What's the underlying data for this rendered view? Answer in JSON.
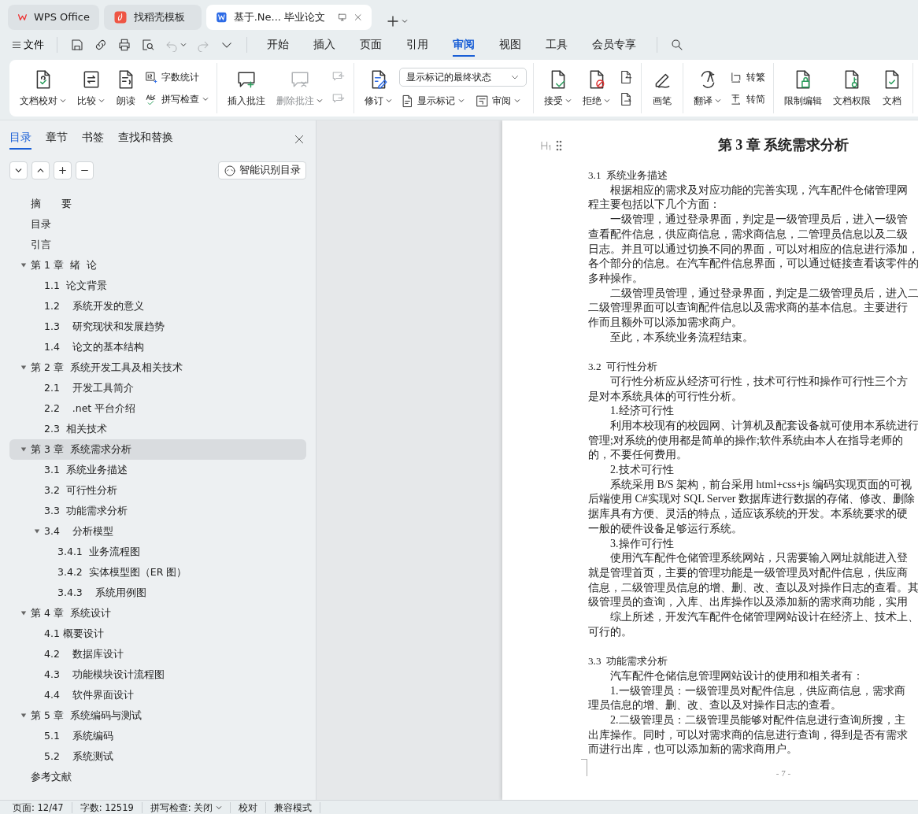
{
  "browser_tabs": [
    {
      "label": "WPS Office",
      "selected": false
    },
    {
      "label": "找稻壳模板",
      "selected": false
    },
    {
      "label": "基于.Ne... 毕业论文",
      "selected": true
    }
  ],
  "menu": {
    "file": "文件",
    "quick_access": [
      {
        "disabled": false
      },
      {
        "disabled": false
      },
      {
        "disabled": false
      },
      {
        "disabled": false
      },
      {
        "disabled": true
      },
      {
        "disabled": true
      },
      {
        "disabled": false
      }
    ],
    "tabs": [
      {
        "label": "开始",
        "selected": false
      },
      {
        "label": "插入",
        "selected": false
      },
      {
        "label": "页面",
        "selected": false
      },
      {
        "label": "引用",
        "selected": false
      },
      {
        "label": "审阅",
        "selected": true
      },
      {
        "label": "视图",
        "selected": false
      },
      {
        "label": "工具",
        "selected": false
      },
      {
        "label": "会员专享",
        "selected": false
      }
    ]
  },
  "ribbon": {
    "groups": [
      {
        "items": [
          {
            "kind": "big",
            "label": "文档校对",
            "dropdown": true,
            "disabled": false
          },
          {
            "kind": "big",
            "label": "比较",
            "dropdown": true,
            "disabled": false
          },
          {
            "kind": "big",
            "label": "朗读",
            "dropdown": false,
            "disabled": false
          },
          {
            "kind": "stack",
            "rows": [
              [
                {
                  "kind": "small",
                  "label": "字数统计",
                  "dropdown": false,
                  "disabled": false
                }
              ],
              [
                {
                  "kind": "small",
                  "label": "拼写检查",
                  "dropdown": true,
                  "disabled": false
                }
              ]
            ]
          }
        ]
      },
      {
        "items": [
          {
            "kind": "big",
            "label": "插入批注",
            "dropdown": false,
            "disabled": false
          },
          {
            "kind": "big",
            "label": "删除批注",
            "dropdown": true,
            "disabled": true
          },
          {
            "kind": "stack",
            "rows": [
              [
                {
                  "kind": "icon",
                  "disabled": true
                }
              ],
              [
                {
                  "kind": "icon",
                  "disabled": true
                }
              ]
            ]
          }
        ]
      },
      {
        "items": [
          {
            "kind": "big",
            "label": "修订",
            "dropdown": true,
            "disabled": false
          },
          {
            "kind": "stack",
            "rows": [
              [
                {
                  "kind": "select",
                  "label": "显示标记的最终状态",
                  "dropdown": true
                }
              ],
              [
                {
                  "kind": "small",
                  "label": "显示标记",
                  "dropdown": true,
                  "disabled": false
                },
                {
                  "kind": "small",
                  "label": "审阅",
                  "dropdown": true,
                  "disabled": false
                }
              ]
            ]
          }
        ]
      },
      {
        "items": [
          {
            "kind": "big",
            "label": "接受",
            "dropdown": true,
            "disabled": false
          },
          {
            "kind": "big",
            "label": "拒绝",
            "dropdown": true,
            "disabled": false
          },
          {
            "kind": "stack",
            "rows": [
              [
                {
                  "kind": "icon",
                  "disabled": false
                }
              ],
              [
                {
                  "kind": "icon",
                  "disabled": false
                }
              ]
            ]
          }
        ]
      },
      {
        "items": [
          {
            "kind": "big",
            "label": "画笔",
            "dropdown": false,
            "disabled": false
          }
        ]
      },
      {
        "items": [
          {
            "kind": "big",
            "label": "翻译",
            "dropdown": true,
            "disabled": false
          },
          {
            "kind": "stack",
            "rows": [
              [
                {
                  "kind": "small",
                  "label": "转繁",
                  "dropdown": false,
                  "disabled": false
                }
              ],
              [
                {
                  "kind": "small",
                  "label": "转简",
                  "dropdown": false,
                  "disabled": false
                }
              ]
            ]
          }
        ]
      },
      {
        "items": [
          {
            "kind": "big",
            "label": "限制编辑",
            "dropdown": false,
            "disabled": false
          },
          {
            "kind": "big",
            "label": "文档权限",
            "dropdown": false,
            "disabled": false
          },
          {
            "kind": "big",
            "label": "文档",
            "dropdown": false,
            "disabled": false
          }
        ]
      }
    ]
  },
  "sidebar": {
    "tabs": [
      {
        "label": "目录",
        "selected": true
      },
      {
        "label": "章节",
        "selected": false
      },
      {
        "label": "书签",
        "selected": false
      },
      {
        "label": "查找和替换",
        "selected": false
      }
    ],
    "smart_button": "智能识别目录",
    "toc": [
      {
        "label": "摘　　要",
        "selected": false
      },
      {
        "label": "目录",
        "selected": false
      },
      {
        "label": "引言",
        "selected": false
      },
      {
        "label": "第 1 章  绪  论",
        "selected": false,
        "expanded": true,
        "children": [
          {
            "label": "1.1  论文背景",
            "selected": false
          },
          {
            "label": "1.2    系统开发的意义",
            "selected": false
          },
          {
            "label": "1.3    研究现状和发展趋势",
            "selected": false
          },
          {
            "label": "1.4    论文的基本结构",
            "selected": false
          }
        ]
      },
      {
        "label": "第 2 章  系统开发工具及相关技术",
        "selected": false,
        "expanded": true,
        "children": [
          {
            "label": "2.1    开发工具简介",
            "selected": false
          },
          {
            "label": "2.2    .net 平台介绍",
            "selected": false
          },
          {
            "label": "2.3  相关技术",
            "selected": false
          }
        ]
      },
      {
        "label": "第 3 章  系统需求分析",
        "selected": true,
        "expanded": true,
        "children": [
          {
            "label": "3.1  系统业务描述",
            "selected": false
          },
          {
            "label": "3.2  可行性分析",
            "selected": false
          },
          {
            "label": "3.3  功能需求分析",
            "selected": false
          },
          {
            "label": "3.4    分析模型",
            "selected": false,
            "expanded": true,
            "children": [
              {
                "label": "3.4.1  业务流程图",
                "selected": false
              },
              {
                "label": "3.4.2  实体模型图（ER 图）",
                "selected": false
              },
              {
                "label": "3.4.3    系统用例图",
                "selected": false
              }
            ]
          }
        ]
      },
      {
        "label": "第 4 章  系统设计",
        "selected": false,
        "expanded": true,
        "children": [
          {
            "label": "4.1 概要设计",
            "selected": false
          },
          {
            "label": "4.2    数据库设计",
            "selected": false
          },
          {
            "label": "4.3    功能模块设计流程图",
            "selected": false
          },
          {
            "label": "4.4    软件界面设计",
            "selected": false
          }
        ]
      },
      {
        "label": "第 5 章  系统编码与测试",
        "selected": false,
        "expanded": true,
        "children": [
          {
            "label": "5.1    系统编码",
            "selected": false
          },
          {
            "label": "5.2    系统测试",
            "selected": false
          }
        ]
      },
      {
        "label": "参考文献",
        "selected": false
      }
    ]
  },
  "document": {
    "title": "第 3 章  系统需求分析",
    "blocks": [
      {
        "kind": "section",
        "text": "3.1  系统业务描述"
      },
      {
        "kind": "line",
        "indent": true,
        "text": "根据相应的需求及对应功能的完善实现，汽车配件仓储管理网"
      },
      {
        "kind": "line",
        "indent": false,
        "text": "程主要包括以下几个方面："
      },
      {
        "kind": "line",
        "indent": true,
        "text": "一级管理，通过登录界面，判定是一级管理员后，进入一级管"
      },
      {
        "kind": "line",
        "indent": false,
        "text": "查看配件信息，供应商信息，需求商信息，二管理员信息以及二级"
      },
      {
        "kind": "line",
        "indent": false,
        "text": "日志。并且可以通过切换不同的界面，可以对相应的信息进行添加，"
      },
      {
        "kind": "line",
        "indent": false,
        "text": "各个部分的信息。在汽车配件信息界面，可以通过链接查看该零件的"
      },
      {
        "kind": "line",
        "indent": false,
        "text": "多种操作。"
      },
      {
        "kind": "line",
        "indent": true,
        "text": "二级管理员管理，通过登录界面，判定是二级管理员后，进入二"
      },
      {
        "kind": "line",
        "indent": false,
        "text": "二级管理界面可以查询配件信息以及需求商的基本信息。主要进行"
      },
      {
        "kind": "line",
        "indent": false,
        "text": "作而且额外可以添加需求商户。"
      },
      {
        "kind": "line",
        "indent": true,
        "text": "至此，本系统业务流程结束。"
      },
      {
        "kind": "section",
        "text": "3.2  可行性分析"
      },
      {
        "kind": "line",
        "indent": true,
        "text": "可行性分析应从经济可行性，技术可行性和操作可行性三个方"
      },
      {
        "kind": "line",
        "indent": false,
        "text": "是对本系统具体的可行性分析。"
      },
      {
        "kind": "line",
        "indent": true,
        "text": "1.经济可行性"
      },
      {
        "kind": "line",
        "indent": true,
        "text": "利用本校现有的校园网、计算机及配套设备就可使用本系统进行"
      },
      {
        "kind": "line",
        "indent": false,
        "text": "管理;对系统的使用都是简单的操作;软件系统由本人在指导老师的"
      },
      {
        "kind": "line",
        "indent": false,
        "text": "的，不要任何费用。"
      },
      {
        "kind": "line",
        "indent": true,
        "text": "2.技术可行性"
      },
      {
        "kind": "line",
        "indent": true,
        "text": "系统采用 B/S 架构，前台采用 html+css+js 编码实现页面的可视"
      },
      {
        "kind": "line",
        "indent": false,
        "text": "后端使用 C#实现对 SQL Server 数据库进行数据的存储、修改、删除"
      },
      {
        "kind": "line",
        "indent": false,
        "text": "据库具有方便、灵活的特点，适应该系统的开发。本系统要求的硬"
      },
      {
        "kind": "line",
        "indent": false,
        "text": "一般的硬件设备足够运行系统。"
      },
      {
        "kind": "line",
        "indent": true,
        "text": "3.操作可行性"
      },
      {
        "kind": "line",
        "indent": true,
        "text": "使用汽车配件仓储管理系统网站，只需要输入网址就能进入登"
      },
      {
        "kind": "line",
        "indent": false,
        "text": "就是管理首页，主要的管理功能是一级管理员对配件信息，供应商"
      },
      {
        "kind": "line",
        "indent": false,
        "text": "信息，二级管理员信息的增、删、改、查以及对操作日志的查看。其"
      },
      {
        "kind": "line",
        "indent": false,
        "text": "级管理员的查询，入库、出库操作以及添加新的需求商功能，实用"
      },
      {
        "kind": "line",
        "indent": true,
        "text": "综上所述，开发汽车配件仓储管理网站设计在经济上、技术上、"
      },
      {
        "kind": "line",
        "indent": false,
        "text": "可行的。"
      },
      {
        "kind": "section",
        "text": "3.3  功能需求分析"
      },
      {
        "kind": "line",
        "indent": true,
        "text": "汽车配件仓储信息管理网站设计的使用和相关者有："
      },
      {
        "kind": "line",
        "indent": true,
        "text": "1.一级管理员：一级管理员对配件信息，供应商信息，需求商"
      },
      {
        "kind": "line",
        "indent": false,
        "text": "理员信息的增、删、改、查以及对操作日志的查看。"
      },
      {
        "kind": "line",
        "indent": true,
        "text": "2.二级管理员：二级管理员能够对配件信息进行查询所搜，主"
      },
      {
        "kind": "line",
        "indent": false,
        "text": "出库操作。同时，可以对需求商的信息进行查询，得到是否有需求"
      },
      {
        "kind": "line",
        "indent": false,
        "text": "而进行出库，也可以添加新的需求商用户。"
      }
    ],
    "page_number": "- 7 -"
  },
  "status_bar": [
    {
      "label": "页面: 12/47",
      "dropdown": false
    },
    {
      "label": "字数: 12519",
      "dropdown": false
    },
    {
      "label": "拼写检查: 关闭",
      "dropdown": true
    },
    {
      "label": "校对",
      "dropdown": false
    },
    {
      "label": "兼容模式",
      "dropdown": false
    }
  ]
}
